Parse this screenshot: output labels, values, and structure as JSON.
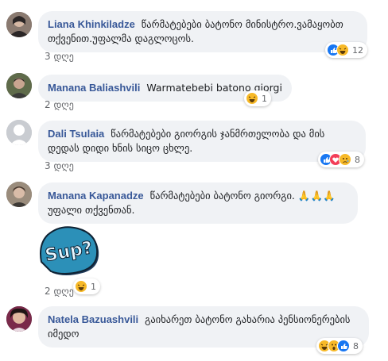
{
  "comments": [
    {
      "name": "Liana Khinkiladze",
      "text": "წარმატებები ბატონო მინისტრო.ვამაყობთ თქვენით.უფალმა დაგლოცოს.",
      "time": "3 დღე",
      "reactions": [
        "like",
        "haha"
      ],
      "count": "12",
      "avatar_color": "#6b5a55"
    },
    {
      "name": "Manana Baliashvili",
      "text": "Warmatebebi batono giorgi",
      "time": "2 დღე",
      "reactions": [
        "haha"
      ],
      "count": "1",
      "avatar_color": "#4a4f3c"
    },
    {
      "name": "Dali Tsulaia",
      "text": "წარმატებები გიორგის ჯანმრთელობა და მის დედას დიდი ხნის სიცო ცხლე.",
      "time": "3 დღე",
      "reactions": [
        "like",
        "love",
        "sad"
      ],
      "count": "8",
      "avatar_color": "#c9ccd1"
    },
    {
      "name": "Manana Kapanadze",
      "text": "წარმატებები ბატონო გიორგი. 🙏🙏🙏 უფალი თქვენთან.",
      "time": "2 დღე",
      "reactions": [
        "haha"
      ],
      "count": "1",
      "sticker": "Sup?",
      "avatar_color": "#7a6c5e"
    },
    {
      "name": "Natela Bazuashvili",
      "text": "გაიხარეთ ბატონო გახარია პენსიონერების იმედო",
      "time": "",
      "reactions": [
        "haha",
        "wow",
        "like"
      ],
      "count": "8",
      "avatar_color": "#3a2330"
    }
  ],
  "colors": {
    "name": "#385898",
    "bubble": "#f0f2f5",
    "meta": "#65676b",
    "sticker_bg": "#2c90b8"
  }
}
